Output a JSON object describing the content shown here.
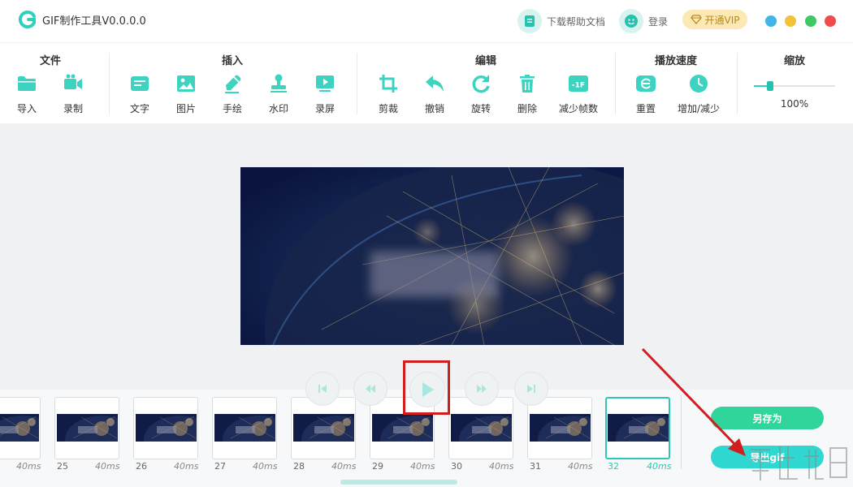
{
  "app": {
    "title": "GIF制作工具V0.0.0.0"
  },
  "titlebar": {
    "help_label": "下载帮助文档",
    "login_label": "登录",
    "vip_label": "开通VIP"
  },
  "toolbar": {
    "groups": [
      {
        "title": "文件",
        "tools": [
          {
            "label": "导入",
            "icon": "folder-icon"
          },
          {
            "label": "录制",
            "icon": "video-camera-icon"
          }
        ]
      },
      {
        "title": "插入",
        "tools": [
          {
            "label": "文字",
            "icon": "text-icon"
          },
          {
            "label": "图片",
            "icon": "image-icon"
          },
          {
            "label": "手绘",
            "icon": "pencil-icon"
          },
          {
            "label": "水印",
            "icon": "stamp-icon"
          },
          {
            "label": "录屏",
            "icon": "screen-record-icon"
          }
        ]
      },
      {
        "title": "编辑",
        "tools": [
          {
            "label": "剪裁",
            "icon": "crop-icon"
          },
          {
            "label": "撤销",
            "icon": "undo-icon"
          },
          {
            "label": "旋转",
            "icon": "rotate-icon"
          },
          {
            "label": "删除",
            "icon": "trash-icon"
          },
          {
            "label": "减少帧数",
            "icon": "reduce-frames-icon",
            "badge": "-1F"
          }
        ]
      },
      {
        "title": "播放速度",
        "tools": [
          {
            "label": "重置",
            "icon": "reset-icon"
          },
          {
            "label": "增加/减少",
            "icon": "clock-icon"
          }
        ]
      },
      {
        "title": "缩放",
        "tools": []
      }
    ],
    "zoom": {
      "value_label": "100%",
      "level": 0.2
    }
  },
  "timeline": {
    "frames": [
      {
        "number": "",
        "duration": "40ms"
      },
      {
        "number": "25",
        "duration": "40ms"
      },
      {
        "number": "26",
        "duration": "40ms"
      },
      {
        "number": "27",
        "duration": "40ms"
      },
      {
        "number": "28",
        "duration": "40ms"
      },
      {
        "number": "29",
        "duration": "40ms"
      },
      {
        "number": "30",
        "duration": "40ms"
      },
      {
        "number": "31",
        "duration": "40ms"
      },
      {
        "number": "32",
        "duration": "40ms",
        "selected": true
      }
    ],
    "save_as_label": "另存为",
    "export_label": "导出gif"
  },
  "colors": {
    "accent": "#2fd1bd",
    "save_green": "#2fd59a",
    "export_cyan": "#2ed8d1",
    "highlight_red": "#d11f1f"
  }
}
